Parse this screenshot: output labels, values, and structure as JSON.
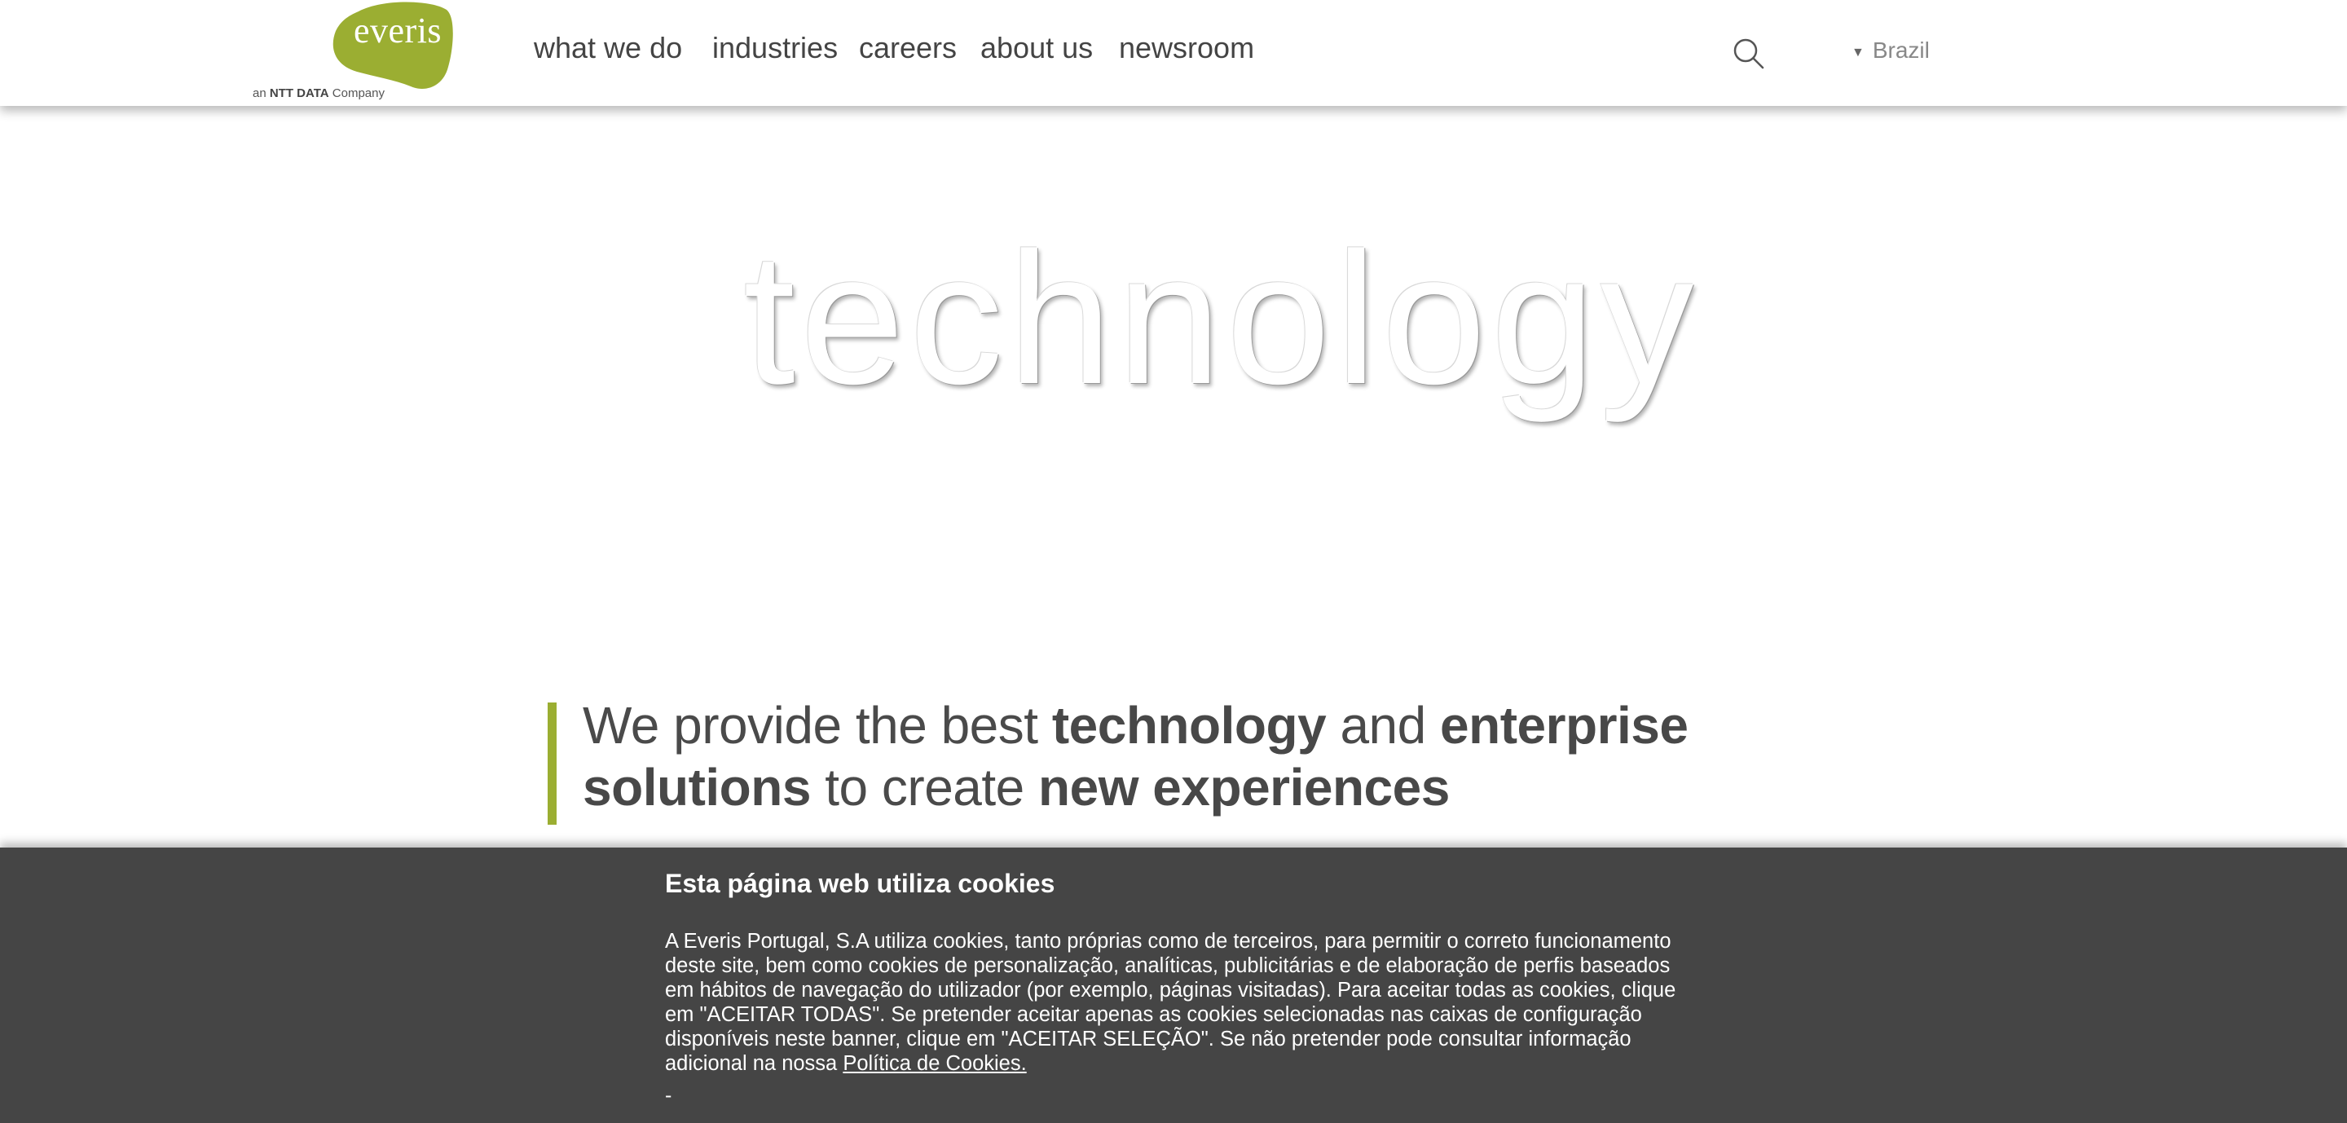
{
  "header": {
    "logo": {
      "wordmark": "everis",
      "tagline_prefix": "an",
      "tagline_brand": "NTT DATA",
      "tagline_suffix": "Company",
      "brand_color": "#9bae32"
    },
    "nav": [
      {
        "label": "what we do"
      },
      {
        "label": "industries"
      },
      {
        "label": "careers"
      },
      {
        "label": "about us"
      },
      {
        "label": "newsroom"
      }
    ],
    "search_icon": "search-icon",
    "country_selector": {
      "chevron": "▼",
      "label": "Brazil"
    }
  },
  "hero": {
    "word": "technology"
  },
  "tagline": {
    "p1": "We provide the best ",
    "b1": "technology",
    "p2": " and ",
    "b2": "enterprise solutions",
    "p3": " to create ",
    "b3": "new experiences",
    "accent_color": "#9bae32"
  },
  "cookie_banner": {
    "title": "Esta página web utiliza cookies",
    "body": "A Everis Portugal, S.A utiliza cookies, tanto próprias como de terceiros, para permitir o correto funcionamento deste site, bem como cookies de personalização, analíticas, publicitárias e de elaboração de perfis baseados em hábitos de navegação do utilizador (por exemplo, páginas visitadas). Para aceitar todas as cookies, clique em \"ACEITAR TODAS\". Se pretender aceitar apenas as cookies selecionadas nas caixas de configuração disponíveis neste banner, clique em \"ACEITAR SELEÇÃO\". Se não pretender pode consultar informação adicional na nossa ",
    "policy_link": "Política de Cookies. ",
    "dash": "-",
    "background": "#454545"
  }
}
